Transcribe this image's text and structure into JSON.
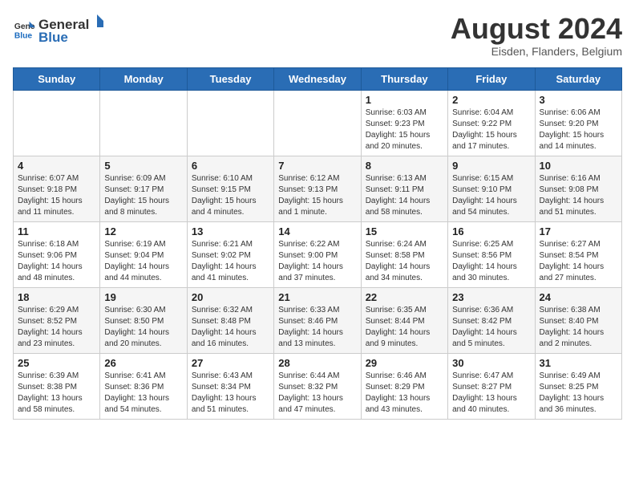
{
  "header": {
    "logo_general": "General",
    "logo_blue": "Blue",
    "title": "August 2024",
    "subtitle": "Eisden, Flanders, Belgium"
  },
  "weekdays": [
    "Sunday",
    "Monday",
    "Tuesday",
    "Wednesday",
    "Thursday",
    "Friday",
    "Saturday"
  ],
  "weeks": [
    [
      {
        "day": "",
        "info": ""
      },
      {
        "day": "",
        "info": ""
      },
      {
        "day": "",
        "info": ""
      },
      {
        "day": "",
        "info": ""
      },
      {
        "day": "1",
        "info": "Sunrise: 6:03 AM\nSunset: 9:23 PM\nDaylight: 15 hours\nand 20 minutes."
      },
      {
        "day": "2",
        "info": "Sunrise: 6:04 AM\nSunset: 9:22 PM\nDaylight: 15 hours\nand 17 minutes."
      },
      {
        "day": "3",
        "info": "Sunrise: 6:06 AM\nSunset: 9:20 PM\nDaylight: 15 hours\nand 14 minutes."
      }
    ],
    [
      {
        "day": "4",
        "info": "Sunrise: 6:07 AM\nSunset: 9:18 PM\nDaylight: 15 hours\nand 11 minutes."
      },
      {
        "day": "5",
        "info": "Sunrise: 6:09 AM\nSunset: 9:17 PM\nDaylight: 15 hours\nand 8 minutes."
      },
      {
        "day": "6",
        "info": "Sunrise: 6:10 AM\nSunset: 9:15 PM\nDaylight: 15 hours\nand 4 minutes."
      },
      {
        "day": "7",
        "info": "Sunrise: 6:12 AM\nSunset: 9:13 PM\nDaylight: 15 hours\nand 1 minute."
      },
      {
        "day": "8",
        "info": "Sunrise: 6:13 AM\nSunset: 9:11 PM\nDaylight: 14 hours\nand 58 minutes."
      },
      {
        "day": "9",
        "info": "Sunrise: 6:15 AM\nSunset: 9:10 PM\nDaylight: 14 hours\nand 54 minutes."
      },
      {
        "day": "10",
        "info": "Sunrise: 6:16 AM\nSunset: 9:08 PM\nDaylight: 14 hours\nand 51 minutes."
      }
    ],
    [
      {
        "day": "11",
        "info": "Sunrise: 6:18 AM\nSunset: 9:06 PM\nDaylight: 14 hours\nand 48 minutes."
      },
      {
        "day": "12",
        "info": "Sunrise: 6:19 AM\nSunset: 9:04 PM\nDaylight: 14 hours\nand 44 minutes."
      },
      {
        "day": "13",
        "info": "Sunrise: 6:21 AM\nSunset: 9:02 PM\nDaylight: 14 hours\nand 41 minutes."
      },
      {
        "day": "14",
        "info": "Sunrise: 6:22 AM\nSunset: 9:00 PM\nDaylight: 14 hours\nand 37 minutes."
      },
      {
        "day": "15",
        "info": "Sunrise: 6:24 AM\nSunset: 8:58 PM\nDaylight: 14 hours\nand 34 minutes."
      },
      {
        "day": "16",
        "info": "Sunrise: 6:25 AM\nSunset: 8:56 PM\nDaylight: 14 hours\nand 30 minutes."
      },
      {
        "day": "17",
        "info": "Sunrise: 6:27 AM\nSunset: 8:54 PM\nDaylight: 14 hours\nand 27 minutes."
      }
    ],
    [
      {
        "day": "18",
        "info": "Sunrise: 6:29 AM\nSunset: 8:52 PM\nDaylight: 14 hours\nand 23 minutes."
      },
      {
        "day": "19",
        "info": "Sunrise: 6:30 AM\nSunset: 8:50 PM\nDaylight: 14 hours\nand 20 minutes."
      },
      {
        "day": "20",
        "info": "Sunrise: 6:32 AM\nSunset: 8:48 PM\nDaylight: 14 hours\nand 16 minutes."
      },
      {
        "day": "21",
        "info": "Sunrise: 6:33 AM\nSunset: 8:46 PM\nDaylight: 14 hours\nand 13 minutes."
      },
      {
        "day": "22",
        "info": "Sunrise: 6:35 AM\nSunset: 8:44 PM\nDaylight: 14 hours\nand 9 minutes."
      },
      {
        "day": "23",
        "info": "Sunrise: 6:36 AM\nSunset: 8:42 PM\nDaylight: 14 hours\nand 5 minutes."
      },
      {
        "day": "24",
        "info": "Sunrise: 6:38 AM\nSunset: 8:40 PM\nDaylight: 14 hours\nand 2 minutes."
      }
    ],
    [
      {
        "day": "25",
        "info": "Sunrise: 6:39 AM\nSunset: 8:38 PM\nDaylight: 13 hours\nand 58 minutes."
      },
      {
        "day": "26",
        "info": "Sunrise: 6:41 AM\nSunset: 8:36 PM\nDaylight: 13 hours\nand 54 minutes."
      },
      {
        "day": "27",
        "info": "Sunrise: 6:43 AM\nSunset: 8:34 PM\nDaylight: 13 hours\nand 51 minutes."
      },
      {
        "day": "28",
        "info": "Sunrise: 6:44 AM\nSunset: 8:32 PM\nDaylight: 13 hours\nand 47 minutes."
      },
      {
        "day": "29",
        "info": "Sunrise: 6:46 AM\nSunset: 8:29 PM\nDaylight: 13 hours\nand 43 minutes."
      },
      {
        "day": "30",
        "info": "Sunrise: 6:47 AM\nSunset: 8:27 PM\nDaylight: 13 hours\nand 40 minutes."
      },
      {
        "day": "31",
        "info": "Sunrise: 6:49 AM\nSunset: 8:25 PM\nDaylight: 13 hours\nand 36 minutes."
      }
    ]
  ]
}
